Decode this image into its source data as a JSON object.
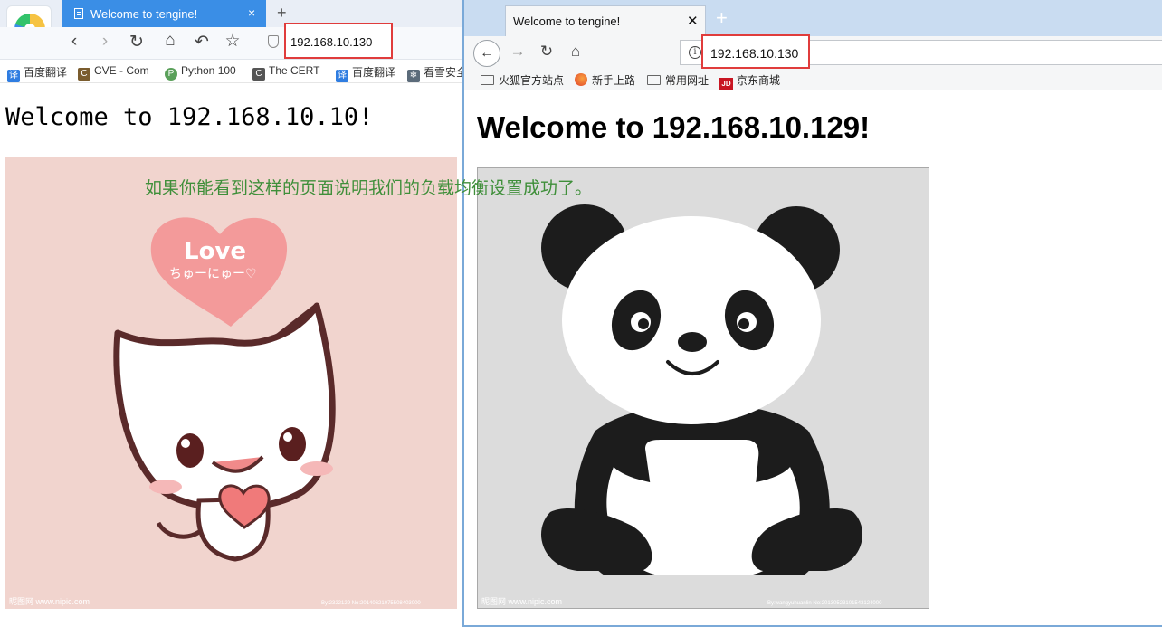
{
  "left_browser": {
    "tab_title": "Welcome to tengine!",
    "tab_close": "×",
    "new_tab": "+",
    "nav": {
      "back": "‹",
      "forward": "›",
      "reload": "↻",
      "home": "⌂",
      "undo": "↶",
      "star": "☆"
    },
    "address": "192.168.10.130",
    "bookmarks": [
      {
        "label": "百度翻译",
        "icon": "translate-icon",
        "color": "#2f7de1",
        "glyph": "译"
      },
      {
        "label": "CVE - Com",
        "icon": "cve-icon",
        "color": "#7a5c2e",
        "glyph": "C"
      },
      {
        "label": "Python 100",
        "icon": "python-icon",
        "color": "#5aa05a",
        "glyph": "P"
      },
      {
        "label": "The CERT",
        "icon": "cert-icon",
        "color": "#555555",
        "glyph": "C"
      },
      {
        "label": "百度翻译",
        "icon": "translate-icon",
        "color": "#2f7de1",
        "glyph": "译"
      },
      {
        "label": "看雪安全",
        "icon": "snowflake-icon",
        "color": "#5b6b7a",
        "glyph": "❄"
      }
    ],
    "heading": "Welcome to 192.168.10.10!",
    "image_caption": "如果你能看到这样的页面说明我们的负载均衡设置成功了。",
    "image_label": "cat holding heart image",
    "heart_text_1": "Love",
    "heart_text_2": "ちゅーにゅー♡",
    "watermark_left": "昵图网 www.nipic.com",
    "watermark_right": "By:2322129 No:20140621075508403000"
  },
  "right_browser": {
    "tab_title": "Welcome to tengine!",
    "tab_close": "✕",
    "new_tab": "+",
    "nav": {
      "back": "←",
      "forward": "→",
      "reload": "↻",
      "home": "⌂",
      "info": "i"
    },
    "address": "192.168.10.130",
    "bookmarks": [
      {
        "label": "火狐官方站点",
        "icon": "folder-icon"
      },
      {
        "label": "新手上路",
        "icon": "firefox-icon"
      },
      {
        "label": "常用网址",
        "icon": "folder-icon"
      },
      {
        "label": "京东商城",
        "icon": "jd-icon",
        "glyph": "JD"
      }
    ],
    "heading": "Welcome to 192.168.10.129!",
    "image_label": "panda image",
    "watermark_left": "昵图网 www.nipic.com",
    "watermark_right": "By:wangyuhuanlin No:20130523101543124000"
  },
  "colors": {
    "left_tab": "#3a8ee6",
    "highlight_box": "#e03c3c",
    "caption_green": "#3f8f3a",
    "cat_bg": "#f1d4ce",
    "panda_bg": "#dcdcdc"
  }
}
